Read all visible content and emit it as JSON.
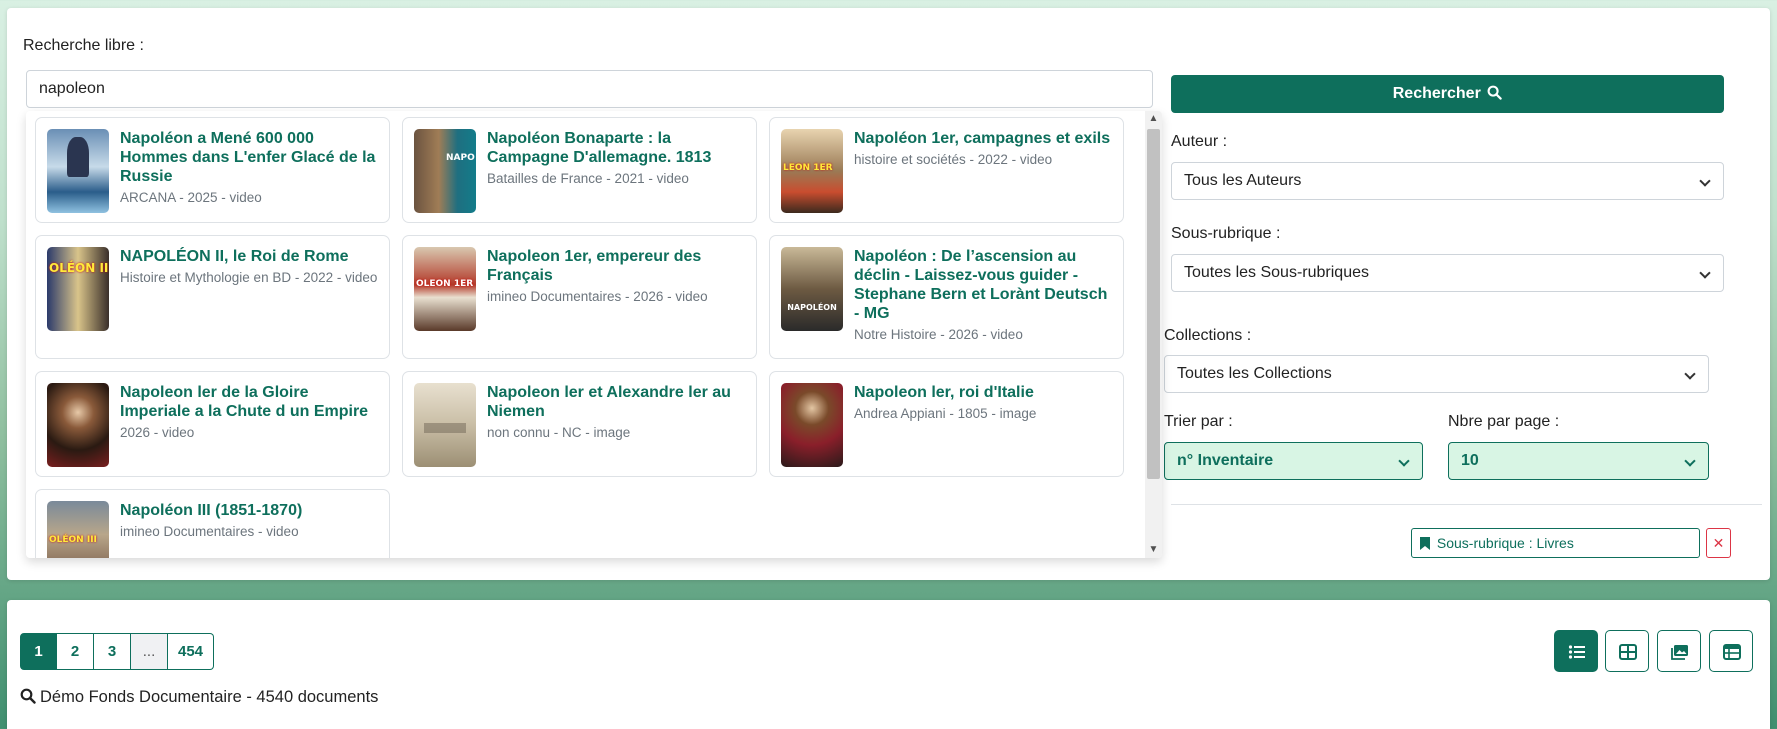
{
  "search": {
    "label": "Recherche libre :",
    "value": "napoleon",
    "button_label": "Rechercher"
  },
  "results": [
    {
      "title": "Napoléon a Mené 600 000 Hommes dans L'enfer Glacé de la Russie",
      "meta": "ARCANA - 2025 - video",
      "thumb_icon": "napoleon-ice-thumbnail"
    },
    {
      "title": "Napoléon Bonaparte : la Campagne D'allemagne. 1813",
      "meta": "Batailles de France - 2021 - video",
      "thumb_icon": "napoleon-allemagne-thumbnail",
      "thumb_tag": "NAPO"
    },
    {
      "title": "Napoléon 1er, campagnes et exils",
      "meta": "histoire et sociétés - 2022 - video",
      "thumb_icon": "napoleon-campagnes-thumbnail",
      "thumb_tag": "LEON 1ER"
    },
    {
      "title": "NAPOLÉON II, le Roi de Rome",
      "meta": "Histoire et Mythologie en BD - 2022 - video",
      "thumb_icon": "napoleon-ii-thumbnail",
      "thumb_tag": "OLÉON II"
    },
    {
      "title": "Napoleon 1er, empereur des Français",
      "meta": "imineo Documentaires - 2026 - video",
      "thumb_icon": "napoleon-empereur-thumbnail",
      "thumb_tag": "OLEON 1ER"
    },
    {
      "title": "Napoléon : De l’ascension au déclin - Laissez-vous guider - Stephane Bern et Lorànt Deutsch - MG",
      "meta": "Notre Histoire - 2026 - video",
      "thumb_icon": "napoleon-ascension-thumbnail",
      "thumb_tag": "NAPOLÉON"
    },
    {
      "title": "Napoleon ler de la Gloire Imperiale a la Chute d un Empire",
      "meta": "2026 - video",
      "thumb_icon": "napoleon-portrait-thumbnail"
    },
    {
      "title": "Napoleon ler et Alexandre ler au Niemen",
      "meta": "non connu - NC - image",
      "thumb_icon": "niemen-engraving-thumbnail"
    },
    {
      "title": "Napoleon ler, roi d'Italie",
      "meta": "Andrea Appiani - 1805 - image",
      "thumb_icon": "roi-italie-painting-thumbnail"
    },
    {
      "title": "Napoléon III (1851-1870)",
      "meta": "imineo Documentaires - video",
      "thumb_icon": "napoleon-iii-thumbnail",
      "thumb_tag": "OLÉON III"
    }
  ],
  "filters": {
    "auteur_label": "Auteur :",
    "auteur_value": "Tous les Auteurs",
    "sousrubrique_label": "Sous-rubrique :",
    "sousrubrique_value": "Toutes les Sous-rubriques",
    "collections_label": "Collections :",
    "collections_value": "Toutes les Collections",
    "trier_label": "Trier par :",
    "trier_value": "n° Inventaire",
    "nbre_label": "Nbre par page :",
    "nbre_value": "10",
    "active_filter": "Sous-rubrique : Livres",
    "active_filter_close": "✕"
  },
  "pagination": [
    "1",
    "2",
    "3",
    "...",
    "454"
  ],
  "summary": "Démo Fonds Documentaire - 4540 documents",
  "colors": {
    "accent": "#0e6f5c",
    "accent_light": "#d8f5e4",
    "danger": "#dc3545"
  }
}
